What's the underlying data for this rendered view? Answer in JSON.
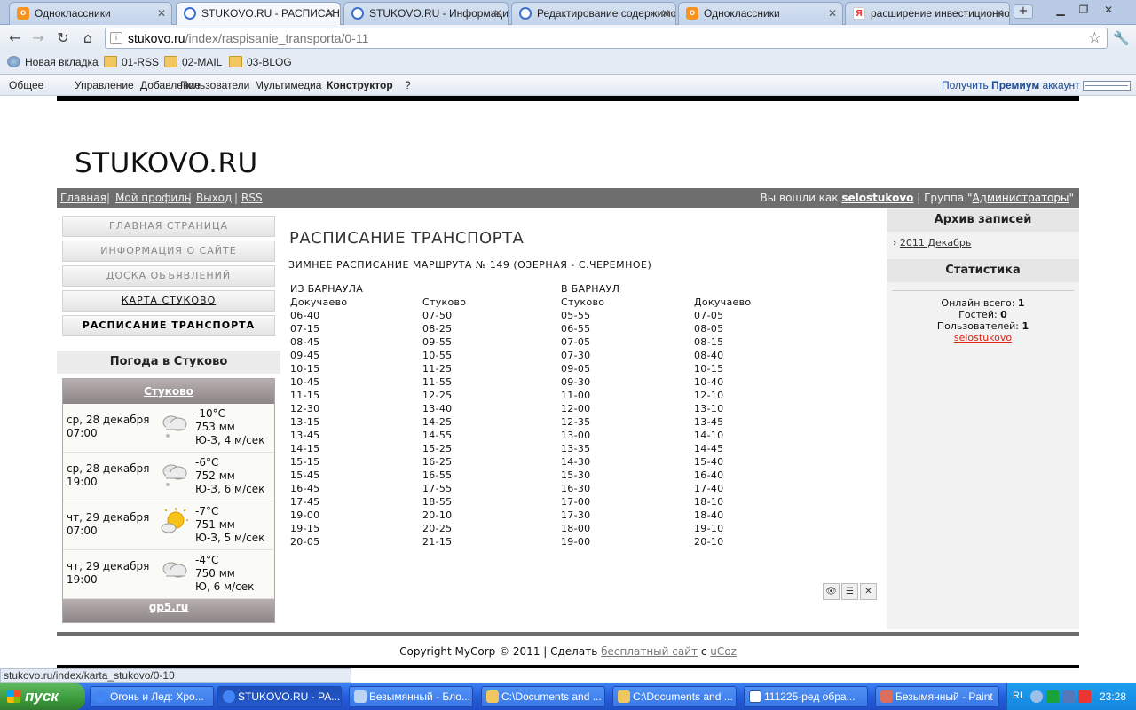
{
  "browser": {
    "tabs": [
      {
        "title": "Одноклассники",
        "icon": "odnoklassniki-icon"
      },
      {
        "title": "STUKOVO.RU - РАСПИСАНИЕ",
        "icon": "ucoz-icon"
      },
      {
        "title": "STUKOVO.RU - Информация",
        "icon": "ucoz-icon"
      },
      {
        "title": "Редактирование содержимо",
        "icon": "ucoz-icon"
      },
      {
        "title": "Одноклассники",
        "icon": "odnoklassniki-icon"
      },
      {
        "title": "расширение инвестиционно",
        "icon": "yandex-icon"
      }
    ],
    "url_domain": "stukovo.ru",
    "url_path": "/index/raspisanie_transporta/0-11",
    "bookmarks": [
      "Новая вкладка",
      "01-RSS",
      "02-MAIL",
      "03-BLOG"
    ],
    "status_url": "stukovo.ru/index/karta_stukovo/0-10"
  },
  "admin_bar": {
    "items": [
      "Общее",
      "Управление",
      "Добавление",
      "Пользователи",
      "Мультимедиа",
      "Конструктор",
      "?"
    ],
    "premium_pre": "Получить ",
    "premium_bold": "Премиум",
    "premium_post": " аккаунт"
  },
  "site": {
    "title": "STUKOVO.RU",
    "nav": [
      "Главная",
      "Мой профиль",
      "Выход",
      "RSS"
    ],
    "login_pre": "Вы вошли как ",
    "login_user": "selostukovo",
    "login_mid": " | Группа \"",
    "login_group": "Администраторы",
    "login_post": "\"",
    "menu": [
      "ГЛАВНАЯ СТРАНИЦА",
      "ИНФОРМАЦИЯ О САЙТЕ",
      "ДОСКА ОБЪЯВЛЕНИЙ",
      "КАРТА СТУКОВО",
      "РАСПИСАНИЕ ТРАНСПОРТА"
    ],
    "weather": {
      "title": "Погода в Стуково",
      "location": "Стуково",
      "footer": "gp5.ru",
      "rows": [
        {
          "date": "ср, 28 декабря",
          "time": "07:00",
          "temp": "-10°C",
          "pressure": "753 мм",
          "wind": "Ю-З, 4 м/сек",
          "icon": "cloud-snow-icon"
        },
        {
          "date": "ср, 28 декабря",
          "time": "19:00",
          "temp": "-6°C",
          "pressure": "752 мм",
          "wind": "Ю-З, 6 м/сек",
          "icon": "cloud-snow-icon"
        },
        {
          "date": "чт, 29 декабря",
          "time": "07:00",
          "temp": "-7°C",
          "pressure": "751 мм",
          "wind": "Ю-З, 5 м/сек",
          "icon": "sun-cloud-icon"
        },
        {
          "date": "чт, 29 декабря",
          "time": "19:00",
          "temp": "-4°C",
          "pressure": "750 мм",
          "wind": "Ю, 6 м/сек",
          "icon": "cloud-icon"
        }
      ]
    },
    "content": {
      "heading": "РАСПИСАНИЕ ТРАНСПОРТА",
      "subtitle": "ЗИМНЕЕ РАСПИСАНИЕ МАРШРУТА № 149 (ОЗЕРНАЯ - С.ЧЕРЕМНОЕ)",
      "from_label": "ИЗ БАРНАУЛА",
      "to_label": "В БАРНАУЛ",
      "columns": [
        "Докучаево",
        "Стуково",
        "Стуково",
        "Докучаево"
      ],
      "rows": [
        [
          "06-40",
          "07-50",
          "05-55",
          "07-05"
        ],
        [
          "07-15",
          "08-25",
          "06-55",
          "08-05"
        ],
        [
          "08-45",
          "09-55",
          "07-05",
          "08-15"
        ],
        [
          "09-45",
          "10-55",
          "07-30",
          "08-40"
        ],
        [
          "10-15",
          "11-25",
          "09-05",
          "10-15"
        ],
        [
          "10-45",
          "11-55",
          "09-30",
          "10-40"
        ],
        [
          "11-15",
          "12-25",
          "11-00",
          "12-10"
        ],
        [
          "12-30",
          "13-40",
          "12-00",
          "13-10"
        ],
        [
          "13-15",
          "14-25",
          "12-35",
          "13-45"
        ],
        [
          "13-45",
          "14-55",
          "13-00",
          "14-10"
        ],
        [
          "14-15",
          "15-25",
          "13-35",
          "14-45"
        ],
        [
          "15-15",
          "16-25",
          "14-30",
          "15-40"
        ],
        [
          "15-45",
          "16-55",
          "15-30",
          "16-40"
        ],
        [
          "16-45",
          "17-55",
          "16-30",
          "17-40"
        ],
        [
          "17-45",
          "18-55",
          "17-00",
          "18-10"
        ],
        [
          "19-00",
          "20-10",
          "17-30",
          "18-40"
        ],
        [
          "19-15",
          "20-25",
          "18-00",
          "19-10"
        ],
        [
          "20-05",
          "21-15",
          "19-00",
          "20-10"
        ]
      ]
    },
    "archive": {
      "title": "Архив записей",
      "link": "2011 Декабрь"
    },
    "stats": {
      "title": "Статистика",
      "online_label": "Онлайн всего: ",
      "online": "1",
      "guests_label": "Гостей: ",
      "guests": "0",
      "users_label": "Пользователей: ",
      "users": "1",
      "user_name": "selostukovo"
    },
    "footer": {
      "pre": "Copyright MyCorp © 2011 | Сделать ",
      "link1": "бесплатный сайт",
      "mid": " с ",
      "link2": "uCoz"
    }
  },
  "taskbar": {
    "start": "пуск",
    "tasks": [
      "Огонь и Лед: Хро...",
      "STUKOVO.RU - РА...",
      "Безымянный - Бло...",
      "C:\\Documents and ...",
      "C:\\Documents and ...",
      "111225-ред обра...",
      "Безымянный - Paint"
    ],
    "lang": "RL",
    "clock": "23:28"
  }
}
